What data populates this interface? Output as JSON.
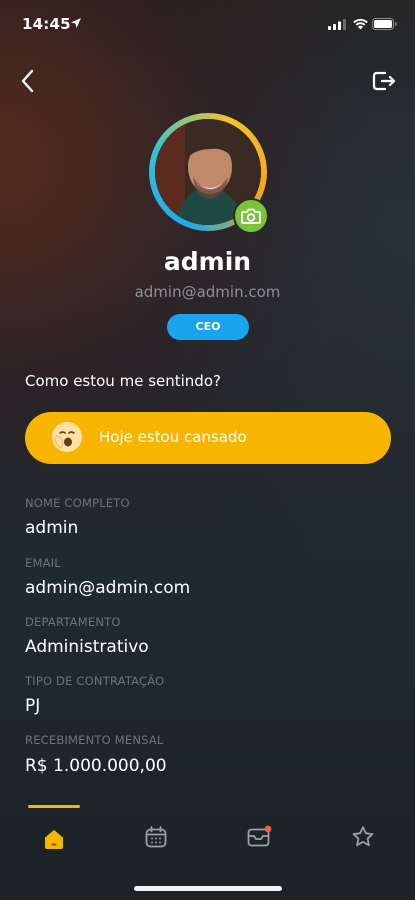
{
  "status_bar": {
    "time": "14:45"
  },
  "header": {
    "back_icon": "chevron-left-icon",
    "logout_icon": "logout-icon"
  },
  "profile": {
    "name": "admin",
    "email": "admin@admin.com",
    "role": "CEO"
  },
  "mood": {
    "question": "Como estou me sentindo?",
    "label": "Hoje estou cansado",
    "icon": "tired-face-emoji"
  },
  "fields": [
    {
      "label": "NOME COMPLETO",
      "value": "admin"
    },
    {
      "label": "EMAIL",
      "value": "admin@admin.com"
    },
    {
      "label": "DEPARTAMENTO",
      "value": "Administrativo"
    },
    {
      "label": "TIPO DE CONTRATAÇÃO",
      "value": "PJ"
    },
    {
      "label": "RECEBIMENTO MENSAL",
      "value": "R$ 1.000.000,00"
    }
  ],
  "tabs": [
    {
      "id": "home",
      "icon": "home-icon",
      "active": true
    },
    {
      "id": "calendar",
      "icon": "calendar-icon",
      "active": false
    },
    {
      "id": "inbox",
      "icon": "mail-icon",
      "active": false,
      "has_notification": true
    },
    {
      "id": "favorites",
      "icon": "star-icon",
      "active": false
    }
  ],
  "colors": {
    "accent": "#f7b500",
    "badge": "#1aa3ee",
    "camera": "#7cc23b",
    "notification": "#ff5a3c"
  }
}
